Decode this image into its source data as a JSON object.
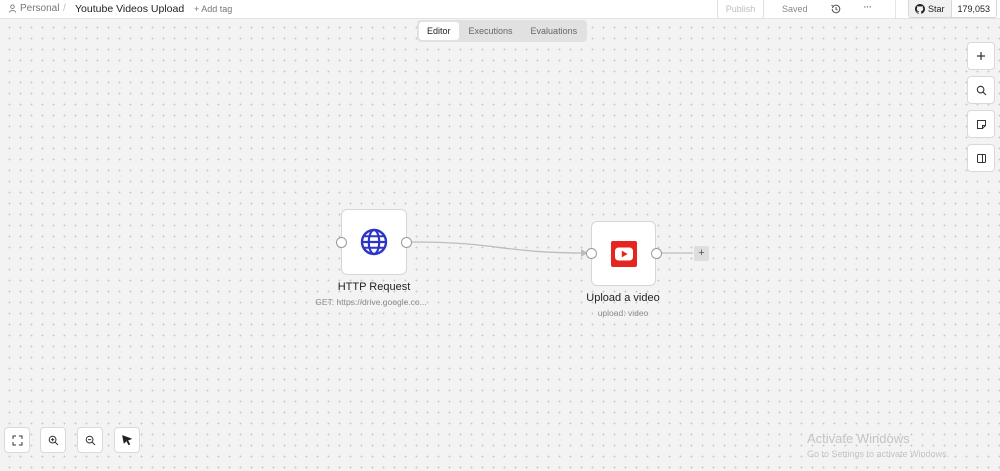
{
  "header": {
    "workspace": "Personal",
    "separator": "/",
    "workflow_title": "Youtube Videos Upload",
    "add_tag": "+ Add tag",
    "publish_label": "Publish",
    "status_text": "Saved",
    "more_label": "···",
    "github": {
      "star_label": "Star",
      "star_count": "179,053"
    }
  },
  "tabs": [
    {
      "label": "Editor",
      "active": true
    },
    {
      "label": "Executions",
      "active": false
    },
    {
      "label": "Evaluations",
      "active": false
    }
  ],
  "right_toolbar": [
    "add-node-icon",
    "search-icon",
    "sticky-note-icon",
    "panel-toggle-icon"
  ],
  "bottom_toolbar": [
    "fit-view-icon",
    "zoom-in-icon",
    "zoom-out-icon",
    "pointer-icon"
  ],
  "nodes": [
    {
      "title": "HTTP Request",
      "subtitle": "GET: https://drive.google.co...",
      "icon": "globe-icon",
      "icon_color": "#2c35c8"
    },
    {
      "title": "Upload a video",
      "subtitle": "upload: video",
      "icon": "youtube-icon",
      "icon_color": "#e5251f"
    }
  ],
  "add_button": "+",
  "watermark": {
    "title": "Activate Windows",
    "subtitle": "Go to Settings to activate Windows."
  },
  "colors": {
    "canvas": "#f3f3f3",
    "edge": "#bdbdbd",
    "youtube_red": "#e5251f",
    "globe_blue": "#2c35c8"
  }
}
